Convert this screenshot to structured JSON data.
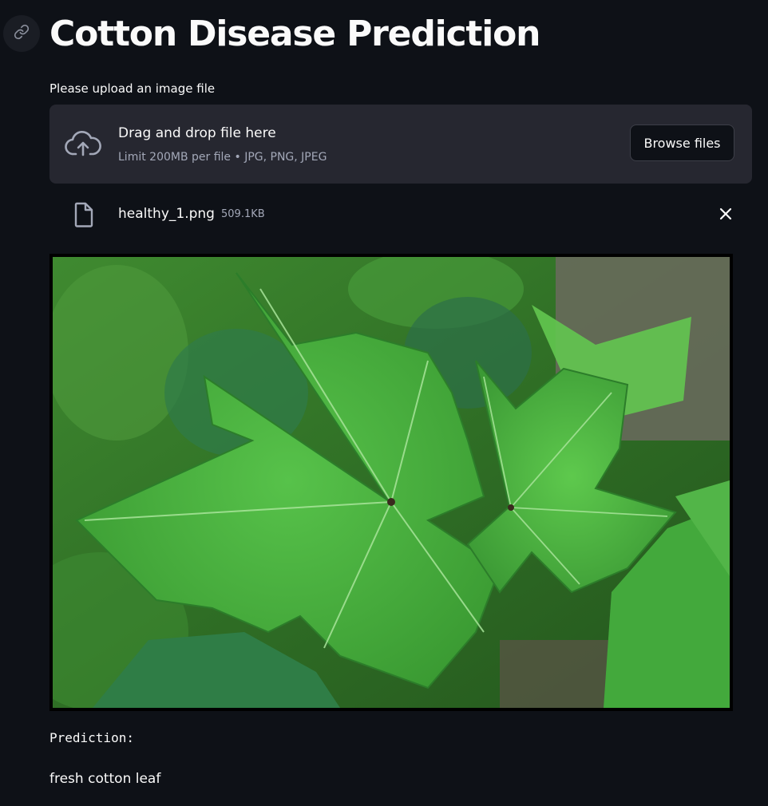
{
  "page": {
    "title": "Cotton Disease Prediction"
  },
  "uploader": {
    "label": "Please upload an image file",
    "drop_title": "Drag and drop file here",
    "limit_text": "Limit 200MB per file • JPG, PNG, JPEG",
    "browse_label": "Browse files",
    "icon": "cloud-upload-icon"
  },
  "uploaded_file": {
    "name": "healthy_1.png",
    "size": "509.1KB",
    "icon": "file-icon"
  },
  "result": {
    "label": "Prediction:",
    "value": "fresh cotton leaf"
  },
  "colors": {
    "background": "#0e1117",
    "dropzone": "#262730",
    "text": "#fafafa",
    "muted_text": "#a3a8b8"
  }
}
